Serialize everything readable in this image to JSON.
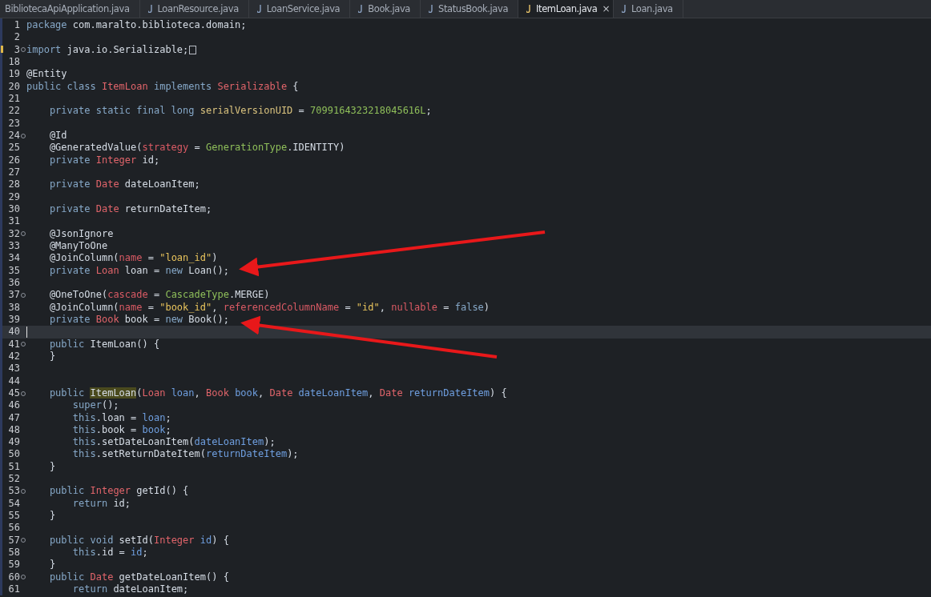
{
  "tabs": [
    {
      "label": "BibliotecaApiApplication.java",
      "selected": false,
      "icon": false
    },
    {
      "label": "LoanResource.java",
      "selected": false,
      "icon": true
    },
    {
      "label": "LoanService.java",
      "selected": false,
      "icon": true
    },
    {
      "label": "Book.java",
      "selected": false,
      "icon": true
    },
    {
      "label": "StatusBook.java",
      "selected": false,
      "icon": true
    },
    {
      "label": "ItemLoan.java",
      "selected": true,
      "icon": true,
      "close": "×"
    },
    {
      "label": "Loan.java",
      "selected": false,
      "icon": true
    }
  ],
  "editor": {
    "lines": [
      {
        "number": "1",
        "tokens": [
          {
            "kind": "keyword",
            "text": "package"
          },
          {
            "kind": "plain",
            "text": " com.maralto.biblioteca.domain;"
          }
        ]
      },
      {
        "number": "2"
      },
      {
        "number": "3",
        "fold": true,
        "warning": true,
        "folded_block": true,
        "tokens": [
          {
            "kind": "keyword",
            "text": "import"
          },
          {
            "kind": "plain",
            "text": " java.io.Serializable;"
          }
        ]
      },
      {
        "number": "18"
      },
      {
        "number": "19",
        "tokens": [
          {
            "kind": "plain",
            "text": "@Entity"
          }
        ]
      },
      {
        "number": "20",
        "tokens": [
          {
            "kind": "keyword",
            "text": "public class "
          },
          {
            "kind": "type",
            "text": "ItemLoan"
          },
          {
            "kind": "keyword",
            "text": " implements "
          },
          {
            "kind": "type",
            "text": "Serializable"
          },
          {
            "kind": "plain",
            "text": " {"
          }
        ]
      },
      {
        "number": "21"
      },
      {
        "number": "22",
        "tokens": [
          {
            "kind": "keyword",
            "text": "    private static final long "
          },
          {
            "kind": "constant_field",
            "text": "serialVersionUID"
          },
          {
            "kind": "plain",
            "text": " = "
          },
          {
            "kind": "number",
            "text": "7099164323218045616L"
          },
          {
            "kind": "plain",
            "text": ";"
          }
        ]
      },
      {
        "number": "23"
      },
      {
        "number": "24",
        "fold": true,
        "tokens": [
          {
            "kind": "plain",
            "text": "    @Id"
          }
        ]
      },
      {
        "number": "25",
        "tokens": [
          {
            "kind": "plain",
            "text": "    @GeneratedValue("
          },
          {
            "kind": "attribute",
            "text": "strategy"
          },
          {
            "kind": "plain",
            "text": " = "
          },
          {
            "kind": "class",
            "text": "GenerationType"
          },
          {
            "kind": "plain",
            "text": ".IDENTITY)"
          }
        ]
      },
      {
        "number": "26",
        "tokens": [
          {
            "kind": "keyword",
            "text": "    private "
          },
          {
            "kind": "type",
            "text": "Integer"
          },
          {
            "kind": "plain",
            "text": " id;"
          }
        ]
      },
      {
        "number": "27"
      },
      {
        "number": "28",
        "tokens": [
          {
            "kind": "keyword",
            "text": "    private "
          },
          {
            "kind": "type",
            "text": "Date"
          },
          {
            "kind": "plain",
            "text": " dateLoanItem;"
          }
        ]
      },
      {
        "number": "29"
      },
      {
        "number": "30",
        "tokens": [
          {
            "kind": "keyword",
            "text": "    private "
          },
          {
            "kind": "type",
            "text": "Date"
          },
          {
            "kind": "plain",
            "text": " returnDateItem;"
          }
        ]
      },
      {
        "number": "31"
      },
      {
        "number": "32",
        "fold": true,
        "tokens": [
          {
            "kind": "plain",
            "text": "    @JsonIgnore"
          }
        ]
      },
      {
        "number": "33",
        "tokens": [
          {
            "kind": "plain",
            "text": "    @ManyToOne"
          }
        ]
      },
      {
        "number": "34",
        "tokens": [
          {
            "kind": "plain",
            "text": "    @JoinColumn("
          },
          {
            "kind": "attribute",
            "text": "name"
          },
          {
            "kind": "plain",
            "text": " = "
          },
          {
            "kind": "string",
            "text": "\"loan_id\""
          },
          {
            "kind": "plain",
            "text": ")"
          }
        ]
      },
      {
        "number": "35",
        "tokens": [
          {
            "kind": "keyword",
            "text": "    private "
          },
          {
            "kind": "type",
            "text": "Loan"
          },
          {
            "kind": "plain",
            "text": " loan = "
          },
          {
            "kind": "keyword",
            "text": "new"
          },
          {
            "kind": "plain",
            "text": " Loan();"
          }
        ]
      },
      {
        "number": "36"
      },
      {
        "number": "37",
        "fold": true,
        "tokens": [
          {
            "kind": "plain",
            "text": "    @OneToOne("
          },
          {
            "kind": "attribute",
            "text": "cascade"
          },
          {
            "kind": "plain",
            "text": " = "
          },
          {
            "kind": "class",
            "text": "CascadeType"
          },
          {
            "kind": "plain",
            "text": ".MERGE)"
          }
        ]
      },
      {
        "number": "38",
        "tokens": [
          {
            "kind": "plain",
            "text": "    @JoinColumn("
          },
          {
            "kind": "attribute",
            "text": "name"
          },
          {
            "kind": "plain",
            "text": " = "
          },
          {
            "kind": "string",
            "text": "\"book_id\""
          },
          {
            "kind": "plain",
            "text": ", "
          },
          {
            "kind": "attribute",
            "text": "referencedColumnName"
          },
          {
            "kind": "plain",
            "text": " = "
          },
          {
            "kind": "string",
            "text": "\"id\""
          },
          {
            "kind": "plain",
            "text": ", "
          },
          {
            "kind": "attribute",
            "text": "nullable"
          },
          {
            "kind": "plain",
            "text": " = "
          },
          {
            "kind": "keyword",
            "text": "false"
          },
          {
            "kind": "plain",
            "text": ")"
          }
        ]
      },
      {
        "number": "39",
        "tokens": [
          {
            "kind": "keyword",
            "text": "    private "
          },
          {
            "kind": "type",
            "text": "Book"
          },
          {
            "kind": "plain",
            "text": " book = "
          },
          {
            "kind": "keyword",
            "text": "new"
          },
          {
            "kind": "plain",
            "text": " Book();"
          }
        ]
      },
      {
        "number": "40",
        "current": true
      },
      {
        "number": "41",
        "fold": true,
        "tokens": [
          {
            "kind": "keyword",
            "text": "    public "
          },
          {
            "kind": "plain",
            "text": "ItemLoan() {"
          }
        ]
      },
      {
        "number": "42",
        "tokens": [
          {
            "kind": "plain",
            "text": "    }"
          }
        ]
      },
      {
        "number": "43"
      },
      {
        "number": "44"
      },
      {
        "number": "45",
        "fold": true,
        "tokens": [
          {
            "kind": "keyword",
            "text": "    public "
          },
          {
            "kind": "match",
            "text": "ItemLoan"
          },
          {
            "kind": "plain",
            "text": "("
          },
          {
            "kind": "type",
            "text": "Loan"
          },
          {
            "kind": "variable",
            "text": " loan"
          },
          {
            "kind": "plain",
            "text": ", "
          },
          {
            "kind": "type",
            "text": "Book"
          },
          {
            "kind": "variable",
            "text": " book"
          },
          {
            "kind": "plain",
            "text": ", "
          },
          {
            "kind": "type",
            "text": "Date"
          },
          {
            "kind": "variable",
            "text": " dateLoanItem"
          },
          {
            "kind": "plain",
            "text": ", "
          },
          {
            "kind": "type",
            "text": "Date"
          },
          {
            "kind": "variable",
            "text": " returnDateItem"
          },
          {
            "kind": "plain",
            "text": ") {"
          }
        ]
      },
      {
        "number": "46",
        "tokens": [
          {
            "kind": "keyword",
            "text": "        super"
          },
          {
            "kind": "plain",
            "text": "();"
          }
        ]
      },
      {
        "number": "47",
        "tokens": [
          {
            "kind": "keyword",
            "text": "        this"
          },
          {
            "kind": "plain",
            "text": ".loan = "
          },
          {
            "kind": "variable",
            "text": "loan"
          },
          {
            "kind": "plain",
            "text": ";"
          }
        ]
      },
      {
        "number": "48",
        "tokens": [
          {
            "kind": "keyword",
            "text": "        this"
          },
          {
            "kind": "plain",
            "text": ".book = "
          },
          {
            "kind": "variable",
            "text": "book"
          },
          {
            "kind": "plain",
            "text": ";"
          }
        ]
      },
      {
        "number": "49",
        "tokens": [
          {
            "kind": "keyword",
            "text": "        this"
          },
          {
            "kind": "plain",
            "text": ".setDateLoanItem("
          },
          {
            "kind": "variable",
            "text": "dateLoanItem"
          },
          {
            "kind": "plain",
            "text": ");"
          }
        ]
      },
      {
        "number": "50",
        "tokens": [
          {
            "kind": "keyword",
            "text": "        this"
          },
          {
            "kind": "plain",
            "text": ".setReturnDateItem("
          },
          {
            "kind": "variable",
            "text": "returnDateItem"
          },
          {
            "kind": "plain",
            "text": ");"
          }
        ]
      },
      {
        "number": "51",
        "tokens": [
          {
            "kind": "plain",
            "text": "    }"
          }
        ]
      },
      {
        "number": "52"
      },
      {
        "number": "53",
        "fold": true,
        "tokens": [
          {
            "kind": "keyword",
            "text": "    public "
          },
          {
            "kind": "type",
            "text": "Integer"
          },
          {
            "kind": "plain",
            "text": " getId() {"
          }
        ]
      },
      {
        "number": "54",
        "tokens": [
          {
            "kind": "keyword",
            "text": "        return"
          },
          {
            "kind": "plain",
            "text": " id;"
          }
        ]
      },
      {
        "number": "55",
        "tokens": [
          {
            "kind": "plain",
            "text": "    }"
          }
        ]
      },
      {
        "number": "56"
      },
      {
        "number": "57",
        "fold": true,
        "tokens": [
          {
            "kind": "keyword",
            "text": "    public void "
          },
          {
            "kind": "plain",
            "text": "setId("
          },
          {
            "kind": "type",
            "text": "Integer"
          },
          {
            "kind": "variable",
            "text": " id"
          },
          {
            "kind": "plain",
            "text": ") {"
          }
        ]
      },
      {
        "number": "58",
        "tokens": [
          {
            "kind": "keyword",
            "text": "        this"
          },
          {
            "kind": "plain",
            "text": ".id = "
          },
          {
            "kind": "variable",
            "text": "id"
          },
          {
            "kind": "plain",
            "text": ";"
          }
        ]
      },
      {
        "number": "59",
        "tokens": [
          {
            "kind": "plain",
            "text": "    }"
          }
        ]
      },
      {
        "number": "60",
        "fold": true,
        "tokens": [
          {
            "kind": "keyword",
            "text": "    public "
          },
          {
            "kind": "type",
            "text": "Date"
          },
          {
            "kind": "plain",
            "text": " getDateLoanItem() {"
          }
        ]
      },
      {
        "number": "61",
        "tokens": [
          {
            "kind": "keyword",
            "text": "        return"
          },
          {
            "kind": "plain",
            "text": " dateLoanItem;"
          }
        ]
      }
    ]
  }
}
